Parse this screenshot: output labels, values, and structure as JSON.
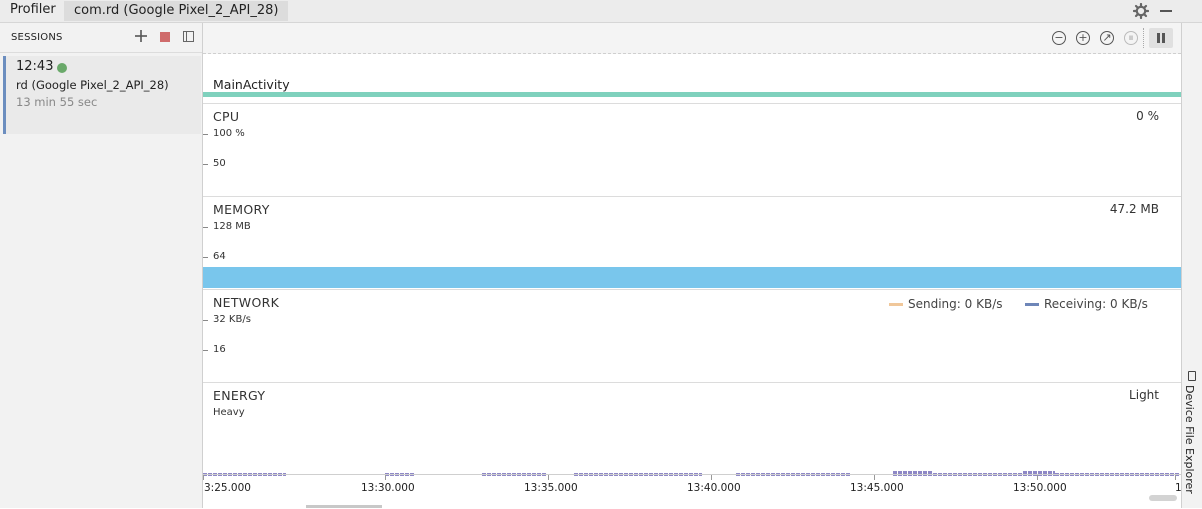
{
  "titlebar": {
    "title": "Profiler",
    "tab": "com.rd (Google Pixel_2_API_28)",
    "icons": [
      "gear-icon",
      "minimize-icon"
    ]
  },
  "sessions": {
    "header": "SESSIONS",
    "icons": [
      "plus-icon",
      "stop-icon",
      "collapse-panel-icon"
    ],
    "items": [
      {
        "time": "12:43",
        "name": "rd (Google Pixel_2_API_28)",
        "duration": "13 min 55 sec",
        "status_color": "#6aa96a",
        "active": true
      }
    ]
  },
  "toolbar": {
    "icons": [
      "zoom-out-icon",
      "zoom-in-icon",
      "reset-zoom-icon",
      "jump-to-live-icon",
      "pause-icon"
    ]
  },
  "activity": {
    "label": "MainActivity",
    "color": "#7fd1bd"
  },
  "cpu": {
    "title": "CPU",
    "value": "0 %",
    "axis_max": "100 %",
    "axis_mid": "50"
  },
  "memory": {
    "title": "MEMORY",
    "value": "47.2 MB",
    "axis_max": "128 MB",
    "axis_mid": "64",
    "color": "#79c6ec"
  },
  "network": {
    "title": "NETWORK",
    "axis_max": "32 KB/s",
    "axis_mid": "16",
    "legend": [
      {
        "label": "Sending: 0 KB/s",
        "color": "#f0c79a"
      },
      {
        "label": "Receiving: 0 KB/s",
        "color": "#6e86b8"
      }
    ]
  },
  "energy": {
    "title": "ENERGY",
    "value": "Light",
    "axis_max": "Heavy",
    "color": "#8e88c6"
  },
  "timeline": {
    "ticks": [
      "3:25.000",
      "13:30.000",
      "13:35.000",
      "13:40.000",
      "13:45.000",
      "13:50.000",
      "1"
    ]
  },
  "side_panel": {
    "label": "Device File Explorer"
  }
}
